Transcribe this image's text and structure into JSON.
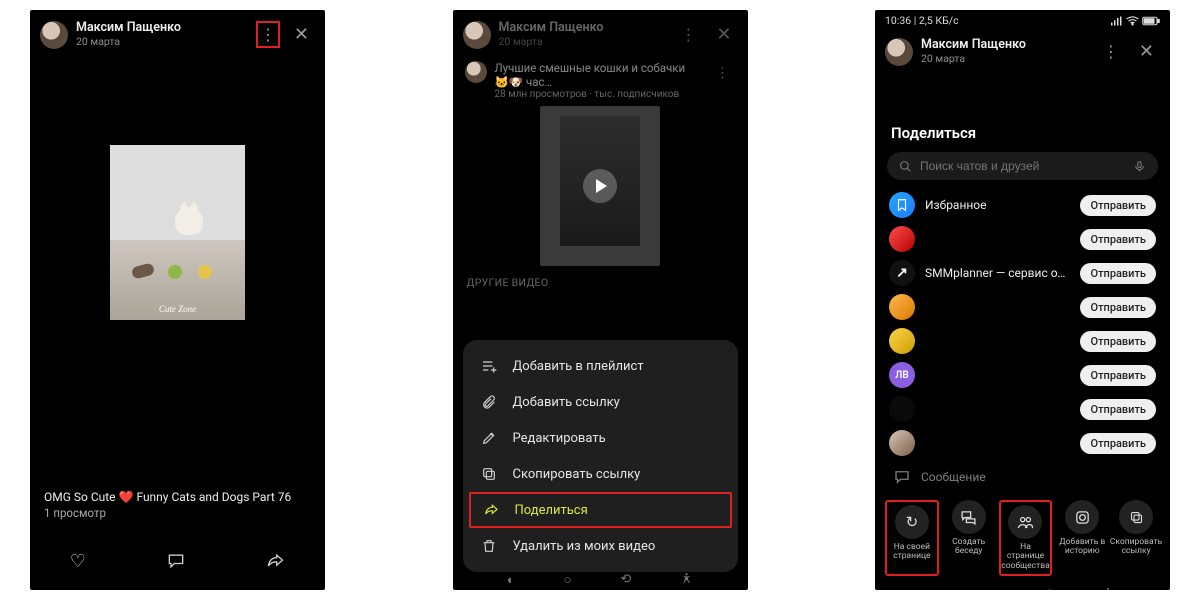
{
  "user": {
    "name": "Максим Пащенко",
    "date": "20 марта"
  },
  "screen1": {
    "watermark": "Cute Zone",
    "caption": "OMG So Cute ❤️ Funny Cats and Dogs Part 76",
    "views": "1 просмотр"
  },
  "screen2": {
    "related": {
      "title": "Лучшие смешные кошки и собачки 🐱🐶 час…",
      "subtitle": "28 млн просмотров · тыс. подписчиков"
    },
    "section_label": "ДРУГИЕ ВИДЕО",
    "menu": {
      "playlist": "Добавить в плейлист",
      "link": "Добавить ссылку",
      "edit": "Редактировать",
      "copy": "Скопировать ссылку",
      "share": "Поделиться",
      "remove": "Удалить из моих видео"
    }
  },
  "screen3": {
    "status_time": "10:36 | 2,5 КБ/с",
    "title": "Поделиться",
    "search_placeholder": "Поиск чатов и друзей",
    "send_label": "Отправить",
    "contacts": {
      "fav": "Избранное",
      "smm": "SMMplanner — сервис отло…",
      "lv": "ЛВ"
    },
    "message_label": "Сообщение",
    "options": {
      "own_page": "На своей странице",
      "chat": "Создать беседу",
      "community": "На странице сообщества",
      "story": "Добавить в историю",
      "copy": "Скопировать ссылку"
    }
  }
}
